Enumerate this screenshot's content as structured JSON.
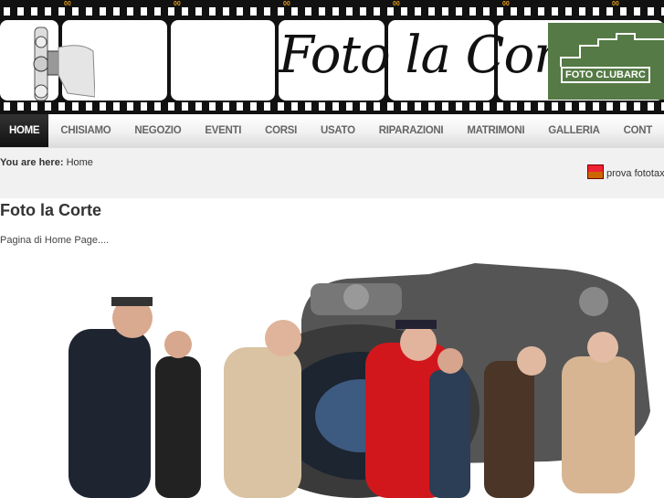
{
  "banner": {
    "script_title": "Foto la Corte",
    "club_logo": "FOTO CLUBARC",
    "film_marks": "00"
  },
  "nav": {
    "items": [
      "HOME",
      "CHISIAMO",
      "NEGOZIO",
      "EVENTI",
      "CORSI",
      "USATO",
      "RIPARAZIONI",
      "MATRIMONI",
      "GALLERIA",
      "CONT"
    ],
    "active": "HOME"
  },
  "breadcrumb": {
    "label": "You are here:",
    "current": "Home"
  },
  "sidebar_link": {
    "label": "prova fototax",
    "icon": "image-thumbnail-icon"
  },
  "article": {
    "title": "Foto la Corte",
    "intro": "Pagina di Home Page...."
  }
}
